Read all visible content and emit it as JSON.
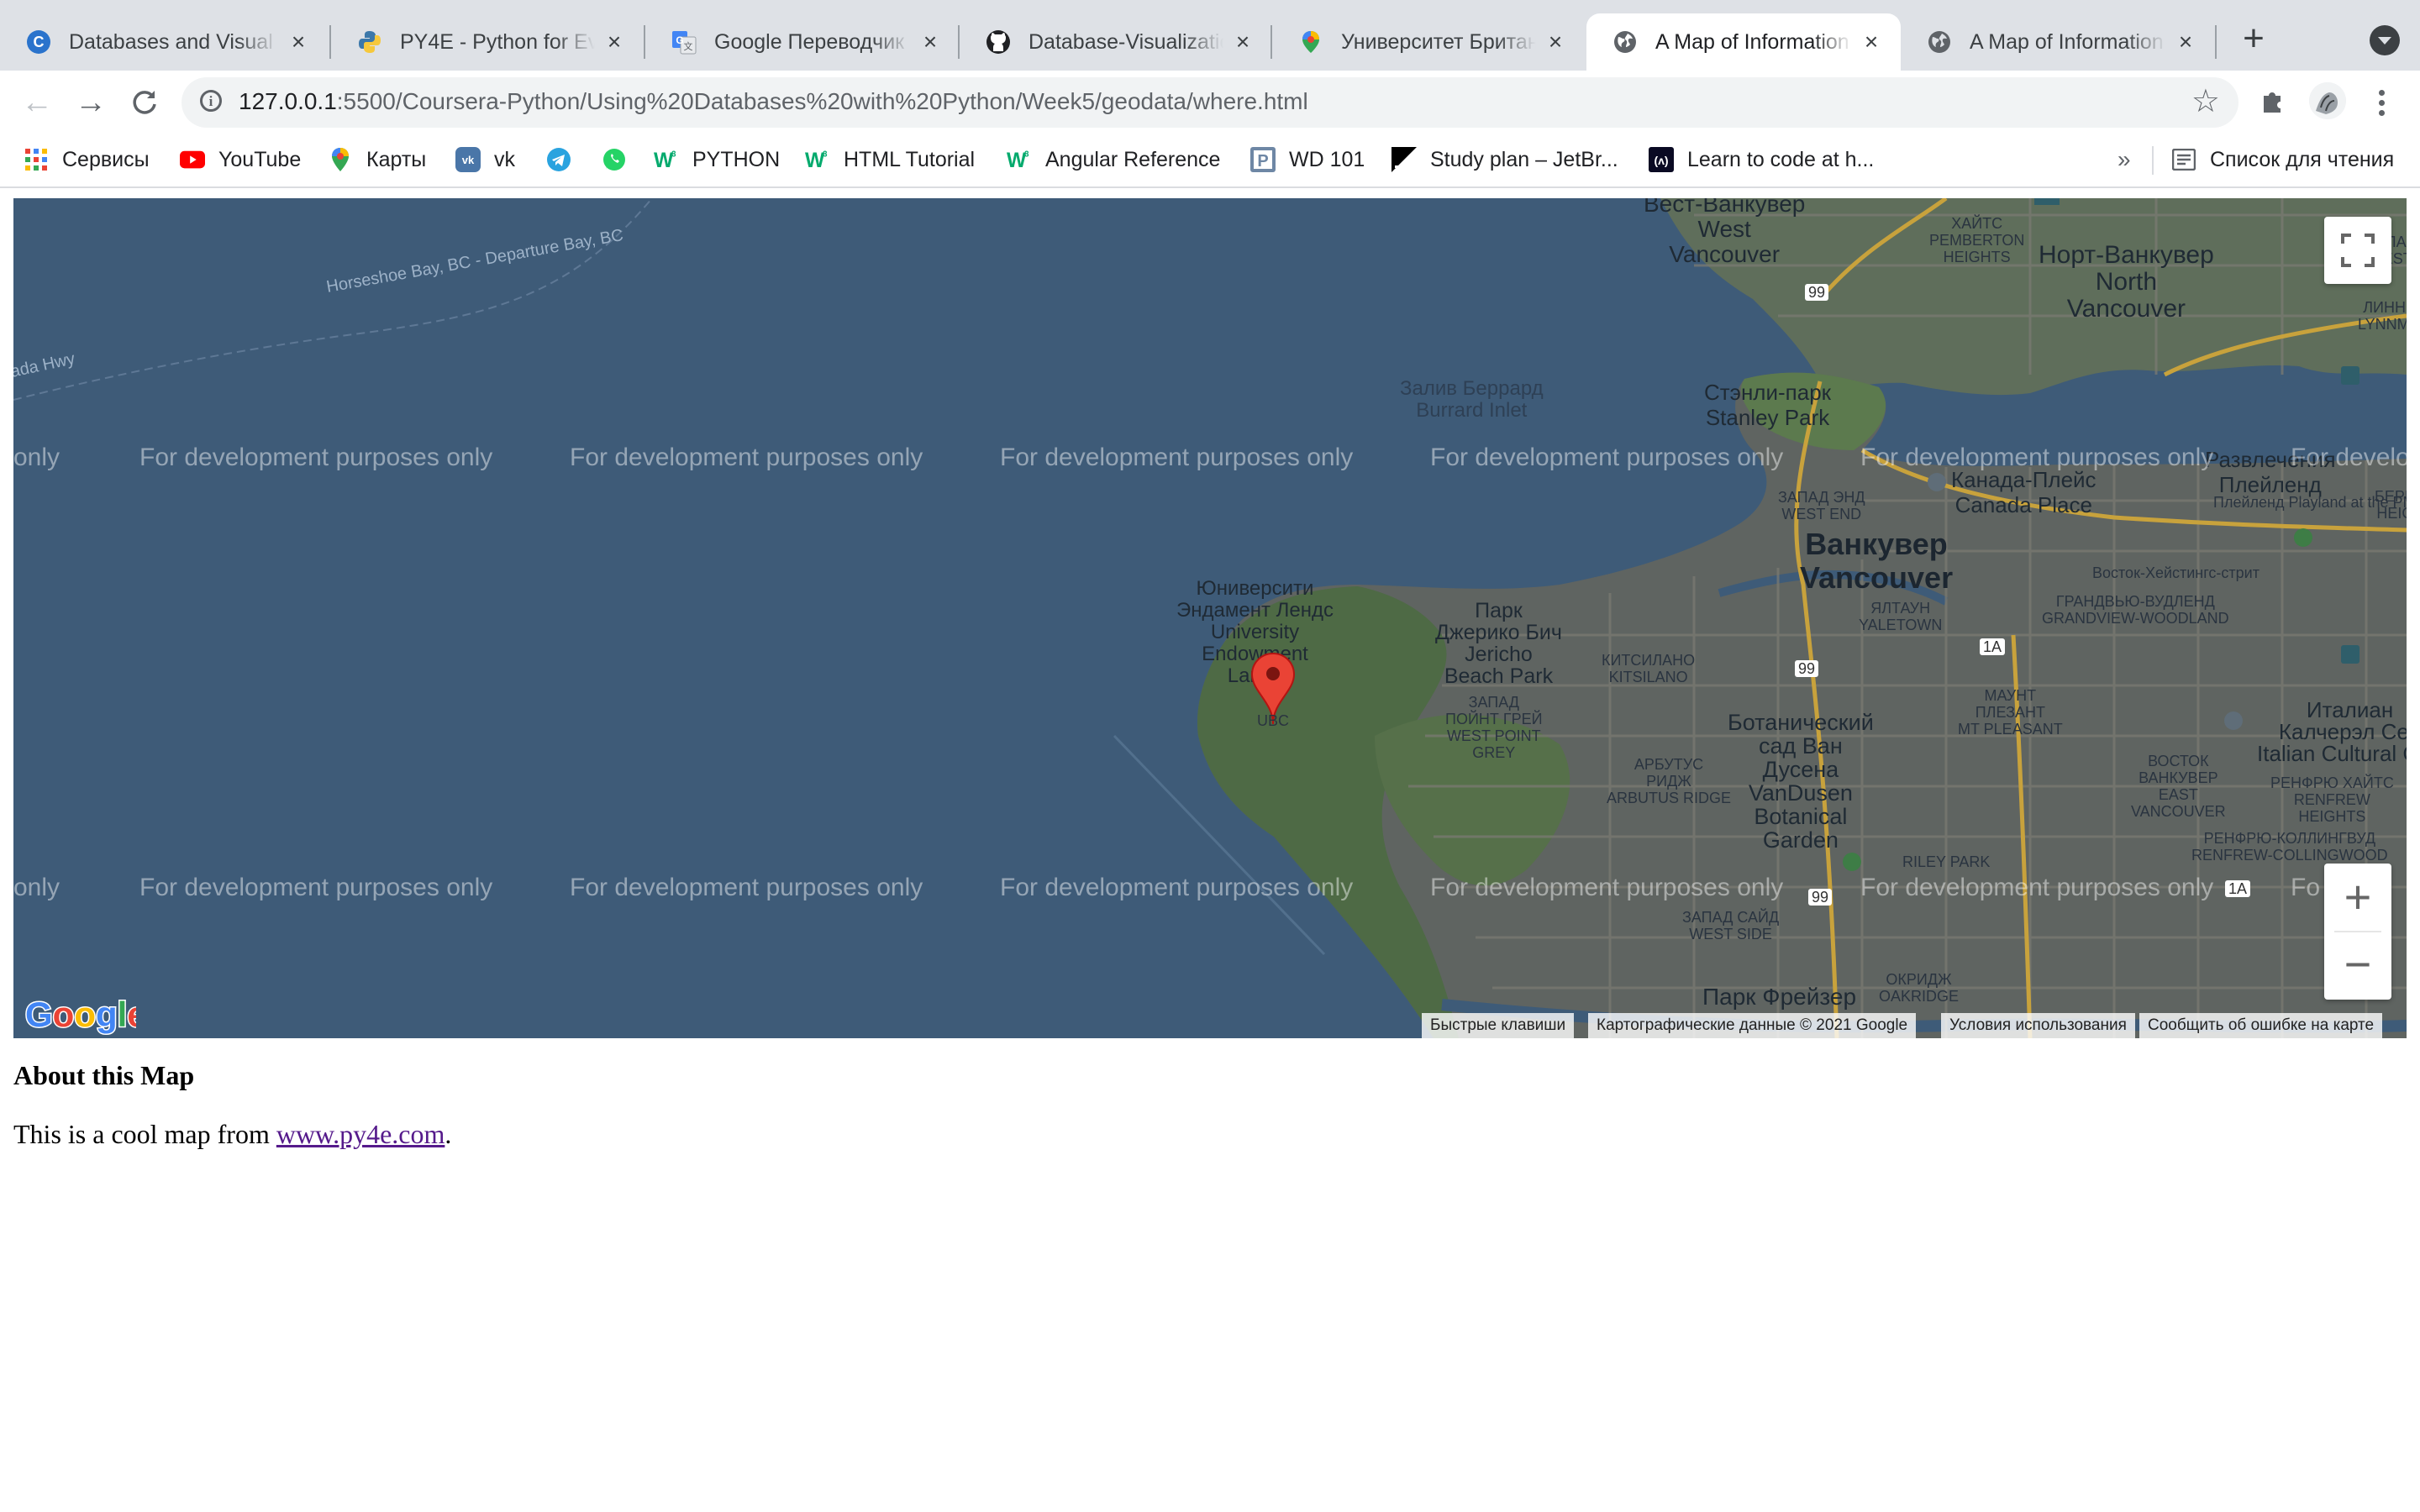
{
  "tabs": [
    {
      "title": "Databases and Visual",
      "icon": "coursera-icon",
      "active": false
    },
    {
      "title": "PY4E - Python for Eve",
      "icon": "python-icon",
      "active": false
    },
    {
      "title": "Google Переводчик",
      "icon": "google-translate-icon",
      "active": false
    },
    {
      "title": "Database-Visualizatio",
      "icon": "github-icon",
      "active": false
    },
    {
      "title": "Университет Британс",
      "icon": "google-maps-icon",
      "active": false
    },
    {
      "title": "A Map of Information",
      "icon": "globe-icon",
      "active": true
    },
    {
      "title": "A Map of Information",
      "icon": "globe-icon",
      "active": false
    }
  ],
  "omnibox": {
    "host": "127.0.0.1",
    "rest": ":5500/Coursera-Python/Using%20Databases%20with%20Python/Week5/geodata/where.html"
  },
  "bookmarks": [
    {
      "label": "Сервисы",
      "icon": "apps-grid-icon"
    },
    {
      "label": "YouTube",
      "icon": "youtube-icon"
    },
    {
      "label": "Карты",
      "icon": "google-maps-icon"
    },
    {
      "label": "vk",
      "icon": "vk-icon"
    },
    {
      "label": "",
      "icon": "telegram-icon"
    },
    {
      "label": "",
      "icon": "whatsapp-icon"
    },
    {
      "label": "PYTHON",
      "icon": "w3schools-icon"
    },
    {
      "label": "HTML Tutorial",
      "icon": "w3schools-icon"
    },
    {
      "label": "Angular Reference",
      "icon": "w3schools-icon"
    },
    {
      "label": "WD 101",
      "icon": "p-icon"
    },
    {
      "label": "Study plan – JetBr...",
      "icon": "jetbrains-icon"
    },
    {
      "label": "Learn to code at h...",
      "icon": "freecodecamp-icon"
    }
  ],
  "bookmarks_more": "»",
  "reading_list": "Список для чтения",
  "map": {
    "watermark": "For development purposes only",
    "watermark_clip_left": "only",
    "watermark_clip_right": "For develo",
    "watermark_clip_right_2": "Fo",
    "labels": {
      "west_vancouver": "Вест-Ванкувер\nWest\nVancouver",
      "north_vancouver": "Норт-Ванкувер\nNorth\nVancouver",
      "burrard_inlet": "Залив Беррард\nBurrard Inlet",
      "stanley_park": "Стэнли-парк\nStanley Park",
      "canada_place": "Канада-Плейс\nCanada Place",
      "vancouver": "Ванкувер\nVancouver",
      "ubc": "Юниверсити\nЭндамент Лендс\nUniversity\nEndowment\nLands",
      "jericho": "Парк\nДжерико Бич\nJericho\nBeach Park",
      "west_point_grey": "ЗАПАД\nПОЙНТ ГРЕЙ\nWEST POINT\nGREY",
      "kitsilano": "КИТСИЛАНО\nKITSILANO",
      "botanical": "Ботанический\nсад Ван\nДусена\nVanDusen\nBotanical\nGarden",
      "arbutus": "АРБУТУС\nРИДЖ\nARBUTUS RIDGE",
      "mount_pleasant": "МАУНТ\nПЛЕЗАНТ\nMT PLEASANT",
      "italian_center": "Италиан\nКалчерэл Сен\nItalian Cultural Cen",
      "east_vancouver": "ВОСТОК\nВАНКУВЕР\nEAST\nVANCOUVER",
      "renfrew": "РЕНФРЮ ХАЙТС\nRENFREW\nHEIGHTS",
      "renfrew_collingwood": "РЕНФРЮ-КОЛЛИНГВУД\nRENFREW-COLLINGWOOD",
      "grandview": "ГРАНДВЬЮ-ВУДЛЕНД\nGRANDVIEW-WOODLAND",
      "yaletown": "ЯЛТАУН\nYALETOWN",
      "west_end": "ЗАПАД ЭНД\nWEST END",
      "playland": "Плейленд\nPlayland at the PNE",
      "riley_park": "RILEY PARK",
      "west_side": "ЗАПАД САЙД\nWEST SIDE",
      "oakridge": "ОКРИДЖ\nOAKRIDGE",
      "pacific_spirit": "Парк Фрейзер",
      "pemberton": "ХАЙТС\nPEMBERTON\nHEIGHTS",
      "hastings": "Восток-Хейстингс-стрит",
      "entertainment": "Развлечения\nПлейленд",
      "lynnmour": "ЛИННМУР\nLYNNMOUR",
      "ferry": "Horseshoe Bay, BC - Departure Bay, BC",
      "hwy": "ada Hwy",
      "ubc_marker": "UBC",
      "west_li": "ЗАПАД Л\nWEST LI",
      "berkeley": "БЕРН\nHEIG"
    },
    "shields": [
      "99",
      "99",
      "1A",
      "99",
      "1A"
    ],
    "attribution": {
      "shortcuts": "Быстрые клавиши",
      "data": "Картографические данные © 2021 Google",
      "terms": "Условия использования",
      "report": "Сообщить об ошибке на карте"
    },
    "zoom_in": "+",
    "zoom_out": "−"
  },
  "content": {
    "heading": "About this Map",
    "text_before": "This is a cool map from ",
    "link": "www.py4e.com",
    "text_after": "."
  }
}
